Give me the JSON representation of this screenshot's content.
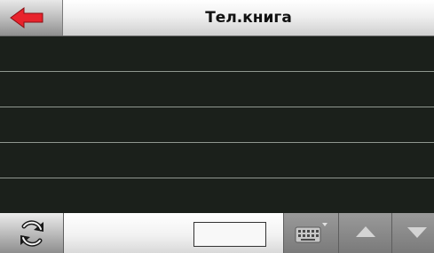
{
  "header": {
    "title": "Тел.книга",
    "back_icon": "left-arrow-icon",
    "back_color": "#e8232c"
  },
  "list": {
    "rows": [
      "",
      "",
      "",
      "",
      ""
    ]
  },
  "toolbar": {
    "refresh_icon": "refresh-icon",
    "search_value": "",
    "keyboard_icon": "keyboard-icon",
    "up_icon": "triangle-up-icon",
    "down_icon": "triangle-down-icon"
  }
}
